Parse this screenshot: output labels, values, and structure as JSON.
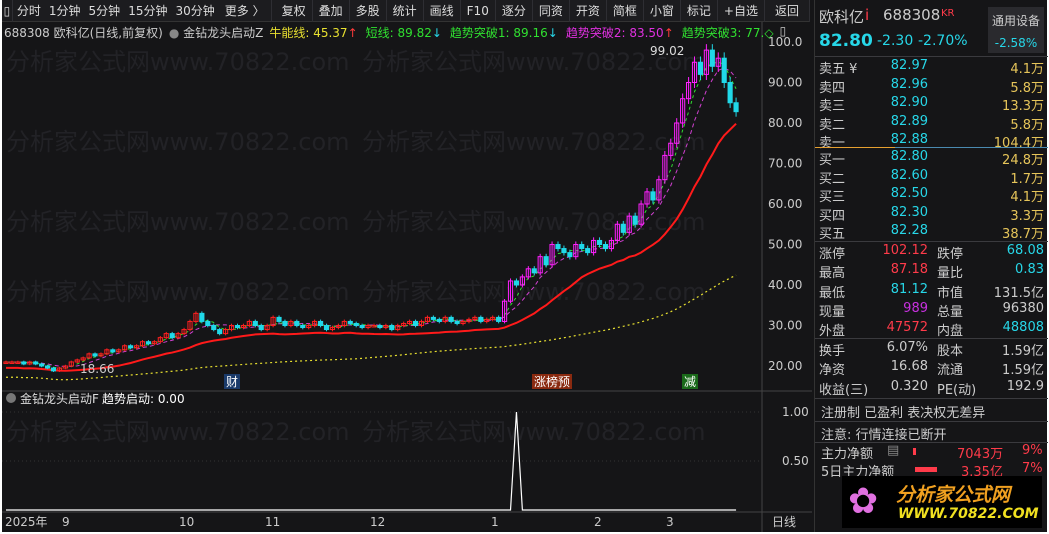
{
  "toolbar": {
    "items": [
      "分时",
      "1分钟",
      "5分钟",
      "15分钟",
      "30分钟",
      "更多 〉"
    ],
    "buttons": [
      "复权",
      "叠加",
      "多股",
      "统计",
      "画线",
      "F10",
      "逐分",
      "同资",
      "开资",
      "简框",
      "小窗",
      "标记",
      "+自选",
      "返回"
    ]
  },
  "legend": {
    "title": "688308 欧科亿(日线,前复权)",
    "indicator": "金钻龙头启动Z",
    "items": [
      {
        "label": "牛能线: 45.37",
        "arrow": "↑",
        "color": "#e8e030",
        "dir": "up"
      },
      {
        "label": "短线: 89.82",
        "arrow": "↓",
        "color": "#30e030",
        "dir": "dn"
      },
      {
        "label": "趋势突破1: 89.16",
        "arrow": "↓",
        "color": "#30e030",
        "dir": "dn"
      },
      {
        "label": "趋势突破2: 83.50",
        "arrow": "↑",
        "color": "#e030e0",
        "dir": "up"
      },
      {
        "label": "趋势突破3: 77.",
        "arrow": "◇",
        "color": "#30e030",
        "dir": "none"
      }
    ]
  },
  "price_axis": [
    "100.0",
    "90.00",
    "80.00",
    "70.00",
    "60.00",
    "50.00",
    "40.00",
    "30.00",
    "20.00"
  ],
  "annotations": {
    "high": "99.02",
    "low": "18.66",
    "events": [
      "财",
      "涨榜预",
      "减"
    ]
  },
  "sub": {
    "indicator": "金钻龙头启动F",
    "value": "趋势启动: 0.00",
    "axis": [
      "1.00",
      "0.50"
    ]
  },
  "date_axis": {
    "labels": [
      "2025年",
      "9",
      "10",
      "11",
      "12",
      "1",
      "2",
      "3"
    ],
    "period": "日线"
  },
  "watermark": "分析家公式网www.70822.com",
  "chart_data": {
    "type": "candlestick",
    "ylim": [
      16,
      102
    ],
    "closes": [
      21,
      21,
      21,
      20.5,
      21,
      20.5,
      20,
      19.5,
      18.8,
      19.5,
      20,
      21,
      21.5,
      22,
      23,
      22.5,
      23,
      24,
      23.5,
      24,
      25,
      24.5,
      25,
      26,
      25.5,
      26,
      27,
      28,
      27,
      28,
      29,
      31,
      33,
      31,
      30,
      29,
      28,
      29,
      30,
      29.5,
      30,
      31,
      30,
      29,
      30,
      32,
      31,
      30,
      31,
      30,
      29.5,
      30,
      31,
      30,
      29,
      29.5,
      30,
      31,
      30.5,
      30,
      29.5,
      30,
      30,
      29.5,
      30,
      29,
      30,
      30.5,
      31,
      30,
      31,
      32,
      31.5,
      31,
      32,
      31,
      30.5,
      31,
      31.5,
      32,
      31,
      31.5,
      32,
      31,
      36,
      41,
      40,
      42,
      44,
      43,
      47,
      45,
      50,
      49,
      48,
      47,
      50,
      49,
      48,
      51,
      50,
      49,
      51,
      55,
      53,
      57,
      55,
      60,
      63,
      61,
      66,
      72,
      75,
      80,
      86,
      90,
      95,
      92,
      98,
      94,
      96,
      90,
      85,
      82.8
    ],
    "signal_bars": [
      86
    ]
  },
  "quote": {
    "name": "欧科亿",
    "name_flag": "i",
    "code": "688308",
    "tag": "KR",
    "sector": "通用设备",
    "sector_change": "-2.58%",
    "price": "82.80",
    "change": "-2.30",
    "pct": "-2.70%",
    "asks": [
      [
        "卖五 ¥",
        "82.97",
        "4.1万"
      ],
      [
        "卖四",
        "82.96",
        "5.8万"
      ],
      [
        "卖三",
        "82.90",
        "13.3万"
      ],
      [
        "卖二",
        "82.89",
        "5.8万"
      ],
      [
        "卖一",
        "82.88",
        "104.4万"
      ]
    ],
    "bids": [
      [
        "买一",
        "82.80",
        "24.8万"
      ],
      [
        "买二",
        "82.60",
        "1.7万"
      ],
      [
        "买三",
        "82.50",
        "4.1万"
      ],
      [
        "买四",
        "82.30",
        "3.3万"
      ],
      [
        "买五",
        "82.28",
        "38.7万"
      ]
    ],
    "stats": [
      [
        "涨停",
        "102.12",
        "跌停",
        "68.08"
      ],
      [
        "最高",
        "87.18",
        "量比",
        "0.83"
      ],
      [
        "最低",
        "81.12",
        "市值",
        "131.5亿"
      ],
      [
        "现量",
        "989",
        "总量",
        "96380"
      ],
      [
        "外盘",
        "47572",
        "内盘",
        "48808"
      ]
    ],
    "stats2": [
      [
        "换手",
        "6.07%",
        "股本",
        "1.59亿"
      ],
      [
        "净资",
        "16.68",
        "流通",
        "1.59亿"
      ],
      [
        "收益(三)",
        "0.320",
        "PE(动)",
        "192.9"
      ]
    ],
    "tags": "注册制 已盈利 表决权无差异",
    "notice": "注意: 行情连接已断开",
    "flows": [
      [
        "主力净额",
        "7043万",
        "9%"
      ],
      [
        "5日主力净额",
        "3.35亿",
        "7%"
      ]
    ]
  },
  "logo": {
    "cn": "分析家公式网",
    "url": "WWW.70822.COM"
  }
}
